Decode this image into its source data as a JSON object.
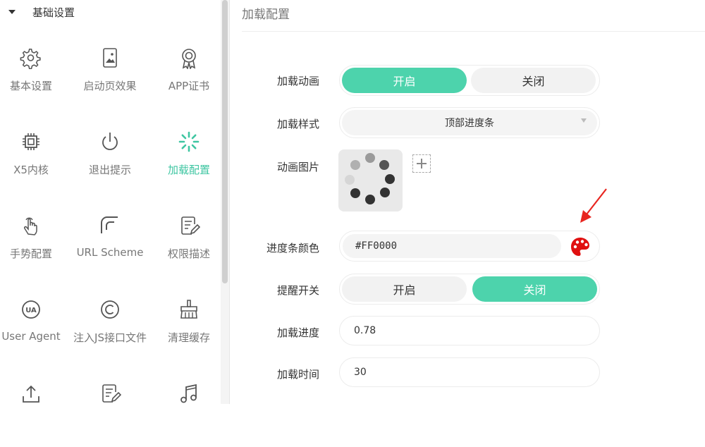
{
  "sidebar": {
    "section_title": "基础设置",
    "items": [
      {
        "label": "基本设置",
        "icon": "gear-icon"
      },
      {
        "label": "启动页效果",
        "icon": "image-icon"
      },
      {
        "label": "APP证书",
        "icon": "certificate-icon"
      },
      {
        "label": "X5内核",
        "icon": "chip-icon"
      },
      {
        "label": "退出提示",
        "icon": "power-icon"
      },
      {
        "label": "加载配置",
        "icon": "loading-icon"
      },
      {
        "label": "手势配置",
        "icon": "hand-gesture-icon"
      },
      {
        "label": "URL Scheme",
        "icon": "url-scheme-icon"
      },
      {
        "label": "权限描述",
        "icon": "edit-doc-icon"
      },
      {
        "label": "User Agent",
        "icon": "ua-icon"
      },
      {
        "label": "注入JS接口文件",
        "icon": "copyright-icon"
      },
      {
        "label": "清理缓存",
        "icon": "broom-icon"
      },
      {
        "label": "",
        "icon": "upload-icon"
      },
      {
        "label": "",
        "icon": "edit-doc-icon"
      },
      {
        "label": "",
        "icon": "music-icon"
      }
    ],
    "active_index": 5
  },
  "main": {
    "title": "加载配置",
    "load_animation": {
      "label": "加载动画",
      "on": "开启",
      "off": "关闭",
      "selected": "on"
    },
    "load_style": {
      "label": "加载样式",
      "value": "顶部进度条"
    },
    "anim_image": {
      "label": "动画图片"
    },
    "progress_color": {
      "label": "进度条颜色",
      "value": "#FF0000"
    },
    "reminder_switch": {
      "label": "提醒开关",
      "on": "开启",
      "off": "关闭",
      "selected": "off"
    },
    "load_progress": {
      "label": "加载进度",
      "value": "0.78"
    },
    "load_time": {
      "label": "加载时间",
      "value": "30"
    }
  },
  "colors": {
    "accent": "#4dd3ac",
    "annotation_arrow": "#e8251f",
    "palette": "#e01010"
  }
}
